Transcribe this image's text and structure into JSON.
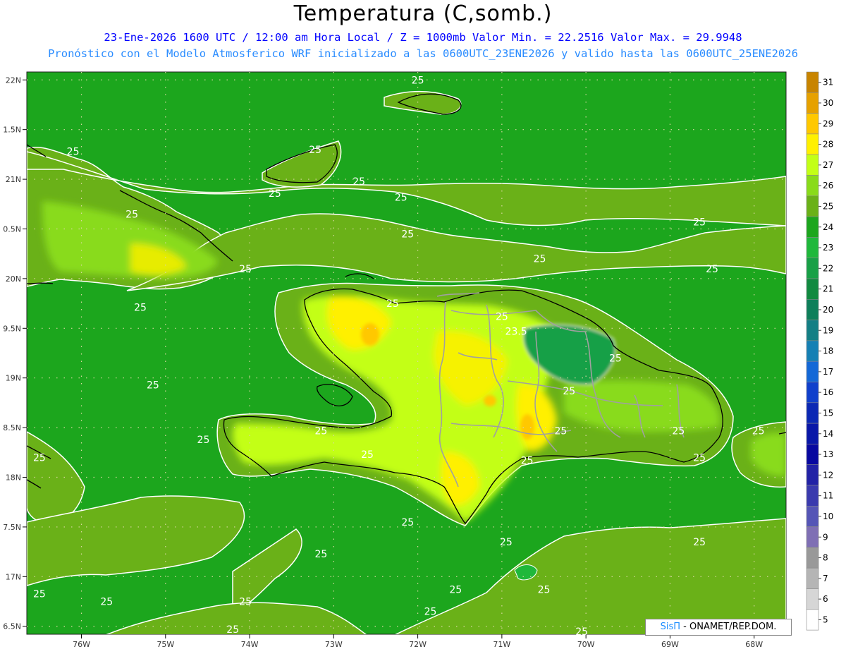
{
  "title": "Temperatura (C,somb.)",
  "subtitle_1": "23-Ene-2026 1600 UTC / 12:00 am Hora Local / Z = 1000mb  Valor Min. = 22.2516  Valor Max. = 29.9948",
  "subtitle_2": "Pronóstico con el Modelo Atmosferico WRF inicializado a las 0600UTC_23ENE2026 y valido hasta las  0600UTC_25ENE2026",
  "credit": {
    "brand": "SisΠ",
    "rest": " - ONAMET/REP.DOM."
  },
  "map": {
    "lon_range": [
      -76.65,
      -67.62
    ],
    "lat_range": [
      16.42,
      22.08
    ],
    "lat_ticks": [
      {
        "value": 22.0,
        "label": "22N"
      },
      {
        "value": 21.5,
        "label": "1.5N"
      },
      {
        "value": 21.0,
        "label": "21N"
      },
      {
        "value": 20.5,
        "label": "0.5N"
      },
      {
        "value": 20.0,
        "label": "20N"
      },
      {
        "value": 19.5,
        "label": "9.5N"
      },
      {
        "value": 19.0,
        "label": "19N"
      },
      {
        "value": 18.5,
        "label": "8.5N"
      },
      {
        "value": 18.0,
        "label": "18N"
      },
      {
        "value": 17.5,
        "label": "7.5N"
      },
      {
        "value": 17.0,
        "label": "17N"
      },
      {
        "value": 16.5,
        "label": "6.5N"
      }
    ],
    "lon_ticks": [
      {
        "value": -76,
        "label": "76W"
      },
      {
        "value": -75,
        "label": "75W"
      },
      {
        "value": -74,
        "label": "74W"
      },
      {
        "value": -73,
        "label": "73W"
      },
      {
        "value": -72,
        "label": "72W"
      },
      {
        "value": -71,
        "label": "71W"
      },
      {
        "value": -70,
        "label": "70W"
      },
      {
        "value": -69,
        "label": "69W"
      },
      {
        "value": -68,
        "label": "68W"
      }
    ],
    "contour_labels": [
      {
        "text": "25",
        "lon": -76.1,
        "lat": 21.28
      },
      {
        "text": "25",
        "lon": -75.4,
        "lat": 20.65
      },
      {
        "text": "25",
        "lon": -75.3,
        "lat": 19.71
      },
      {
        "text": "25",
        "lon": -75.15,
        "lat": 18.93
      },
      {
        "text": "25",
        "lon": -74.05,
        "lat": 20.1
      },
      {
        "text": "25",
        "lon": -73.7,
        "lat": 20.86
      },
      {
        "text": "25",
        "lon": -73.22,
        "lat": 21.3
      },
      {
        "text": "25",
        "lon": -72.7,
        "lat": 20.98
      },
      {
        "text": "25",
        "lon": -72.2,
        "lat": 20.82
      },
      {
        "text": "25",
        "lon": -72.0,
        "lat": 22.0
      },
      {
        "text": "25",
        "lon": -72.12,
        "lat": 20.45
      },
      {
        "text": "25",
        "lon": -72.3,
        "lat": 19.75
      },
      {
        "text": "25",
        "lon": -70.55,
        "lat": 20.2
      },
      {
        "text": "25",
        "lon": -68.65,
        "lat": 20.57
      },
      {
        "text": "25",
        "lon": -68.5,
        "lat": 20.1
      },
      {
        "text": "25",
        "lon": -71.0,
        "lat": 19.62
      },
      {
        "text": "23.5",
        "lon": -70.83,
        "lat": 19.47
      },
      {
        "text": "25",
        "lon": -69.65,
        "lat": 19.2
      },
      {
        "text": "25",
        "lon": -70.2,
        "lat": 18.87
      },
      {
        "text": "25",
        "lon": -70.3,
        "lat": 18.47
      },
      {
        "text": "25",
        "lon": -70.7,
        "lat": 18.17
      },
      {
        "text": "25",
        "lon": -68.9,
        "lat": 18.47
      },
      {
        "text": "25",
        "lon": -68.65,
        "lat": 18.2
      },
      {
        "text": "25",
        "lon": -67.95,
        "lat": 18.47
      },
      {
        "text": "25",
        "lon": -73.15,
        "lat": 18.47
      },
      {
        "text": "25",
        "lon": -74.55,
        "lat": 18.38
      },
      {
        "text": "25",
        "lon": -72.6,
        "lat": 18.23
      },
      {
        "text": "25",
        "lon": -76.5,
        "lat": 18.2
      },
      {
        "text": "25",
        "lon": -72.12,
        "lat": 17.55
      },
      {
        "text": "25",
        "lon": -70.95,
        "lat": 17.35
      },
      {
        "text": "25",
        "lon": -73.15,
        "lat": 17.23
      },
      {
        "text": "25",
        "lon": -68.65,
        "lat": 17.35
      },
      {
        "text": "25",
        "lon": -71.55,
        "lat": 16.87
      },
      {
        "text": "25",
        "lon": -70.5,
        "lat": 16.87
      },
      {
        "text": "25",
        "lon": -76.5,
        "lat": 16.83
      },
      {
        "text": "25",
        "lon": -75.7,
        "lat": 16.75
      },
      {
        "text": "25",
        "lon": -74.05,
        "lat": 16.75
      },
      {
        "text": "25",
        "lon": -71.85,
        "lat": 16.65
      },
      {
        "text": "25",
        "lon": -74.2,
        "lat": 16.47
      },
      {
        "text": "25",
        "lon": -70.05,
        "lat": 16.45
      }
    ]
  },
  "colorbar": {
    "labels": [
      "31",
      "30",
      "29",
      "28",
      "27",
      "26",
      "25",
      "24",
      "23",
      "22",
      "21",
      "20",
      "19",
      "18",
      "17",
      "16",
      "15",
      "14",
      "13",
      "12",
      "11",
      "10",
      "9",
      "8",
      "7",
      "6",
      "5"
    ],
    "colors": [
      "#c88400",
      "#e6a100",
      "#ffc800",
      "#fff000",
      "#c3ff16",
      "#89db1a",
      "#6ab118",
      "#1ca61d",
      "#1fb83b",
      "#18a046",
      "#118a40",
      "#0e7f5a",
      "#137f85",
      "#1580b4",
      "#1468d7",
      "#1040cc",
      "#0b28b4",
      "#0917a8",
      "#0808a0",
      "#2222a6",
      "#3a3aae",
      "#5555b6",
      "#7f6fb4",
      "#999999",
      "#b5b5b5",
      "#d6d6d6",
      "#ffffff"
    ]
  }
}
